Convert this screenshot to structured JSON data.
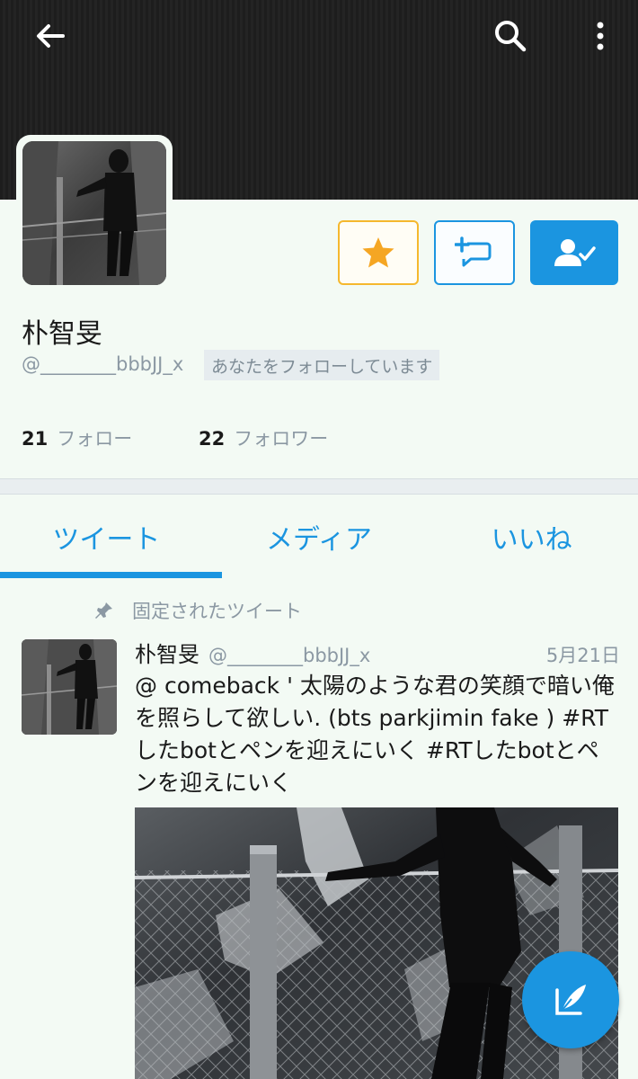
{
  "topbar": {
    "back_icon": "arrow-left-icon",
    "search_icon": "search-icon",
    "more_icon": "more-vert-icon"
  },
  "profile": {
    "name": "朴智旻",
    "handle": "@________bbbJJ_x",
    "follows_you_badge": "あなたをフォローしています",
    "following_count": "21",
    "following_label": "フォロー",
    "followers_count": "22",
    "followers_label": "フォロワー"
  },
  "actions": {
    "favorite_icon": "star-icon",
    "dm_icon": "add-message-icon",
    "follow_icon": "user-check-icon"
  },
  "tabs": [
    {
      "label": "ツイート",
      "active": true
    },
    {
      "label": "メディア",
      "active": false
    },
    {
      "label": "いいね",
      "active": false
    }
  ],
  "tweet": {
    "pinned_label": "固定されたツイート",
    "name": "朴智旻",
    "handle": "@________bbbJJ_x",
    "date": "5月21日",
    "text": "@ comeback ' 太陽のような君の笑顔で暗い俺を照らして欲しい. (bts parkjimin fake ) #RTしたbotとペンを迎えにいく #RTしたbotとペンを迎えにいく"
  },
  "fab": {
    "icon": "compose-tweet-icon"
  },
  "colors": {
    "accent": "#1b95e0",
    "star": "#f5a623",
    "banner": "#1d1d1d",
    "background": "#f3faf4"
  }
}
